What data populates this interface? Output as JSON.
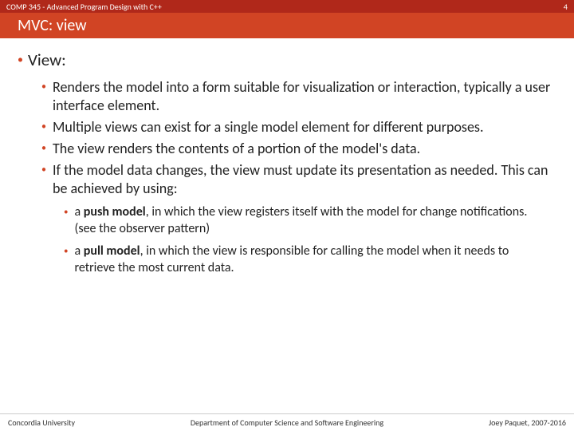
{
  "header": {
    "course": "COMP 345 - Advanced Program Design with C++",
    "page_number": "4",
    "slide_title": "MVC: view"
  },
  "content": {
    "heading": "View:",
    "bullets": [
      "Renders the model into a form suitable for visualization or interaction, typically a user interface element.",
      "Multiple views can exist for a single model element for different purposes.",
      "The view renders the contents of a portion of the model's data.",
      "If the model data changes, the view must update its presentation as needed. This can be achieved by using:"
    ],
    "sub_bullets": [
      {
        "prefix": "a ",
        "bold": "push model",
        "rest": ", in which the view registers itself with the model for change notifications. (see the observer pattern)"
      },
      {
        "prefix": "a ",
        "bold": "pull model",
        "rest": ", in which the view is responsible for calling the model when it needs to retrieve the most current data."
      }
    ]
  },
  "footer": {
    "left": "Concordia University",
    "center": "Department of Computer Science and Software Engineering",
    "right": "Joey Paquet, 2007-2016"
  }
}
